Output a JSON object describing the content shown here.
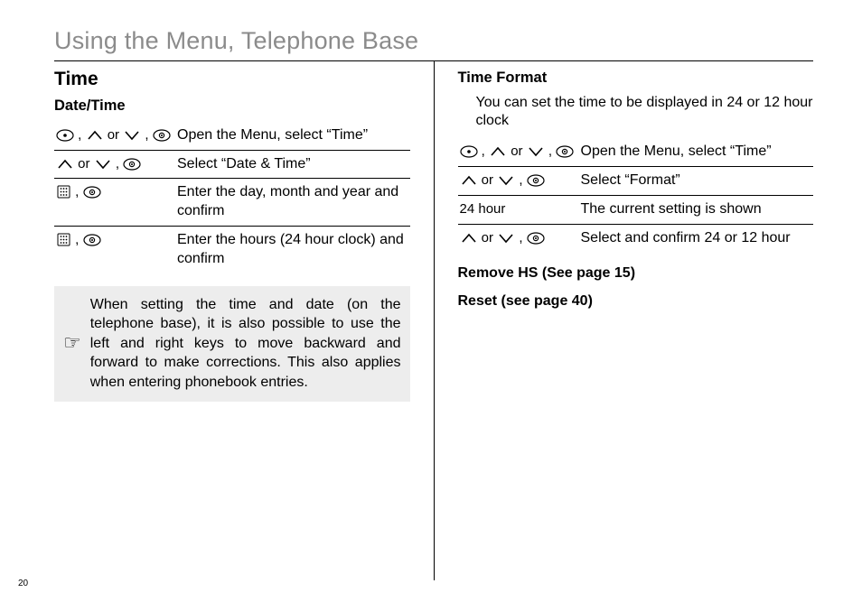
{
  "page_title": "Using the Menu, Telephone Base",
  "page_number": "20",
  "left": {
    "section_title": "Time",
    "subsection_title": "Date/Time",
    "rows": [
      {
        "desc": "Open the Menu, select “Time”"
      },
      {
        "desc": "Select “Date & Time”"
      },
      {
        "desc": "Enter the day, month and year and confirm"
      },
      {
        "desc": "Enter the hours (24 hour clock) and confirm"
      }
    ],
    "note": "When setting the time and date (on the telephone base), it is also possible to use the left and right keys to move backward and forward to make corrections. This also applies when entering phonebook entries."
  },
  "right": {
    "subsection_title": "Time Format",
    "intro": "You can set the time to be displayed in 24 or 12 hour clock",
    "rows": [
      {
        "keys_text": "",
        "desc": "Open the Menu, select “Time”"
      },
      {
        "keys_text": "",
        "desc": "Select “Format”"
      },
      {
        "keys_text": "24 hour",
        "desc": "The current setting is shown"
      },
      {
        "keys_text": "",
        "desc": "Select and confirm 24 or 12 hour"
      }
    ],
    "cross_ref_1": "Remove HS (See page 15)",
    "cross_ref_2": "Reset (see page 40)"
  },
  "glyphs": {
    "or": "or",
    "comma": ","
  }
}
